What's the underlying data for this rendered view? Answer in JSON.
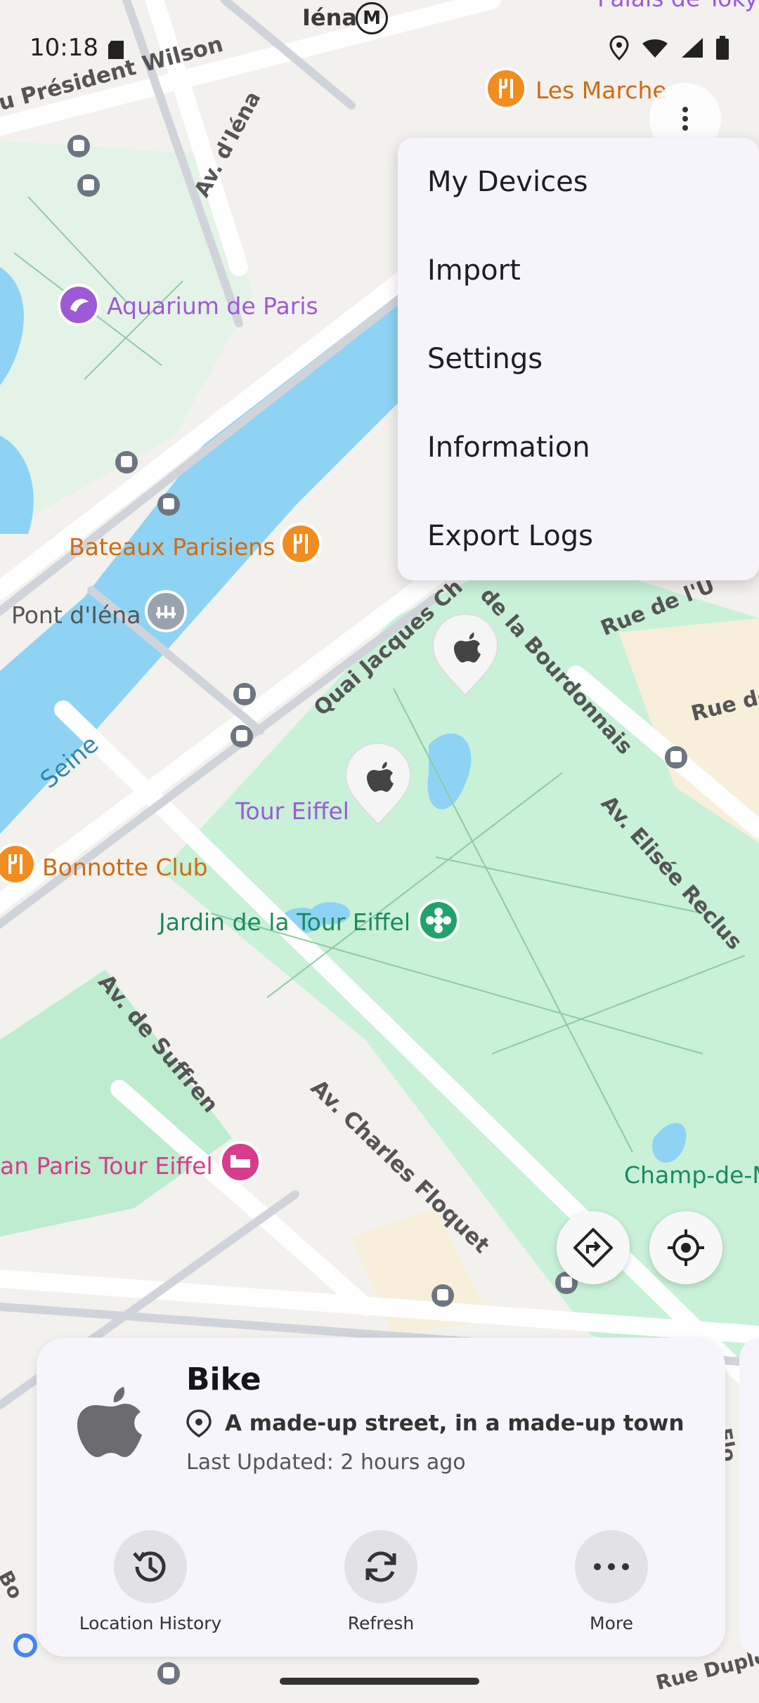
{
  "status_bar": {
    "time": "10:18"
  },
  "map": {
    "labels": {
      "iena": "Iéna",
      "metro": "M",
      "president_wilson": "u Président Wilson",
      "av_iena": "Av. d'Iéna",
      "aquarium": "Aquarium de Paris",
      "bateaux": "Bateaux Parisiens",
      "pont_iena": "Pont d'Iéna",
      "seine": "Seine",
      "quai": "Quai Jacques Ch",
      "bourdonnais": "de la Bourdonnais",
      "rue_de_lu": "Rue de l'U",
      "rue_de": "Rue de",
      "elisee": "Av. Elisée Reclus",
      "tour_eiffel": "Tour Eiffel",
      "bonnotte": "Bonnotte Club",
      "jardin": "Jardin de la Tour Eiffel",
      "suffren": "Av. de Suffren",
      "floquet": "Av. Charles Floquet",
      "pullman": "an Paris Tour Eiffel",
      "champ": "Champ-de-M",
      "marche": "Les Marche",
      "palais": "Palais de Toky",
      "rue_duple": "Rue Duple",
      "bo": "Bo",
      "flo": "Flo"
    },
    "colors": {
      "water": "#8fd3f4",
      "park": "#c8f1d8",
      "road": "#ffffff",
      "poi_food": "#f28c1e",
      "poi_purple": "#9c5ad6",
      "poi_green": "#1fa36a"
    }
  },
  "menu": {
    "items": [
      "My Devices",
      "Import",
      "Settings",
      "Information",
      "Export Logs"
    ]
  },
  "device_card": {
    "name": "Bike",
    "address": "A made-up street, in a made-up town",
    "last_updated": "Last Updated: 2 hours ago",
    "actions": {
      "history": "Location History",
      "refresh": "Refresh",
      "more": "More"
    }
  }
}
